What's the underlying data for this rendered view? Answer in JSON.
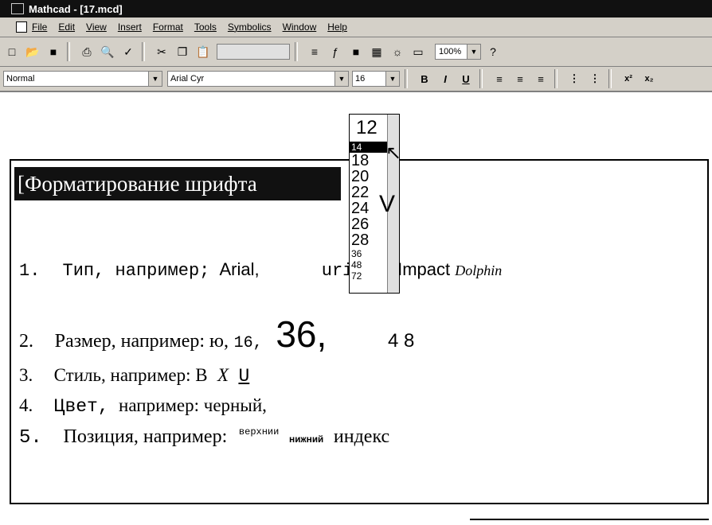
{
  "titlebar": {
    "title": "Mathcad - [17.mcd]"
  },
  "menu": [
    "File",
    "Edit",
    "View",
    "Insert",
    "Format",
    "Tools",
    "Symbolics",
    "Window",
    "Help"
  ],
  "toolbar": {
    "zoom": "100%",
    "help_glyph": "?"
  },
  "format": {
    "style": "Normal",
    "font": "Arial Cyr",
    "size": "16",
    "bold": "B",
    "italic": "I",
    "underline": "U",
    "superscript": "x²",
    "subscript": "x₂"
  },
  "dropdown": {
    "options": [
      "12",
      "14",
      "18",
      "20",
      "22",
      "24",
      "26",
      "28",
      "36",
      "48",
      "72"
    ],
    "selected": "14",
    "partial": "V"
  },
  "doc": {
    "heading": "[Форматирование шрифта",
    "item1": {
      "num": "1.",
      "prefix": "Тип, например;",
      "arial": "Arial,",
      "courier": "urier,",
      "impact": "Impact",
      "dolphin": "Dolphin"
    },
    "item2": {
      "num": "2.",
      "text": "Размер, например: ю,",
      "v16": "16,",
      "v36": "36,",
      "v48": "4 8"
    },
    "item3": {
      "num": "3.",
      "text": "Стиль, например: В",
      "italic": "X",
      "under": "U"
    },
    "item4": {
      "num": "4.",
      "word": "Цвет,",
      "text": "например: черный,"
    },
    "item5": {
      "num": "5.",
      "text": "Позиция, например:",
      "sup": "верхнии",
      "sub": "нижний",
      "end": "индекс"
    }
  },
  "colors": {
    "chrome": "#d4d0c8",
    "titlebar": "#111111"
  }
}
